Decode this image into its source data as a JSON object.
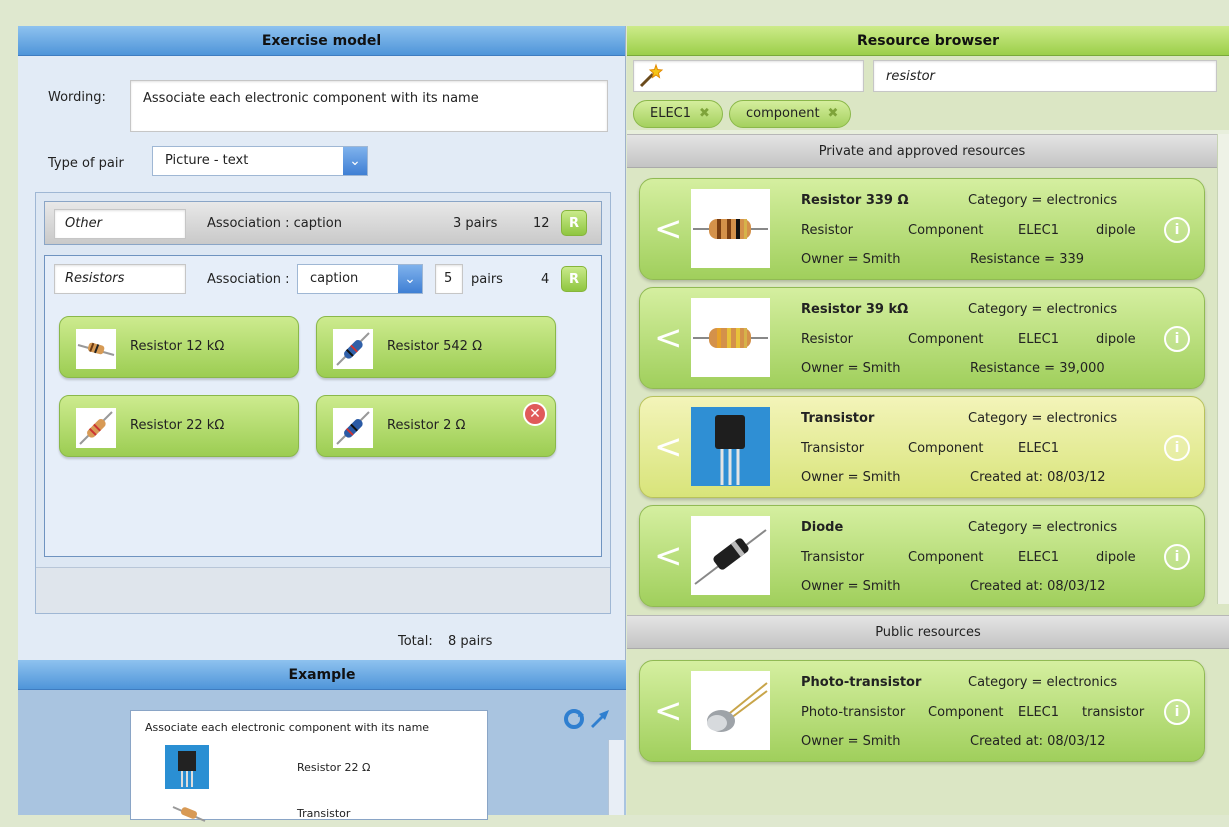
{
  "exercise_panel": {
    "title": "Exercise model",
    "wording_label": "Wording:",
    "wording_value": "Associate each electronic component with its name",
    "pair_type_label": "Type of pair",
    "pair_type_value": "Picture - text",
    "groups": [
      {
        "name": "Other",
        "association_label": "Association : caption",
        "pairs_label": "3 pairs",
        "count": "12",
        "r_label": "R"
      },
      {
        "name": "Resistors",
        "association_label": "Association :",
        "association_value": "caption",
        "pairs_value": "5",
        "pairs_unit": "pairs",
        "count": "4",
        "r_label": "R",
        "items": [
          {
            "label": "Resistor 12 kΩ",
            "icon": "resistor-icon"
          },
          {
            "label": "Resistor 542 Ω",
            "icon": "resistor-blue-icon"
          },
          {
            "label": "Resistor 22 kΩ",
            "icon": "resistor-icon"
          },
          {
            "label": "Resistor 2 Ω",
            "icon": "resistor-blue-icon"
          }
        ]
      }
    ],
    "total_label": "Total:",
    "total_value": "8 pairs"
  },
  "example_panel": {
    "title": "Example",
    "preview_heading": "Associate each electronic component with its name",
    "preview_rows": [
      "Resistor 22 Ω",
      "Transistor"
    ]
  },
  "resource_browser": {
    "title": "Resource browser",
    "search_value": "resistor",
    "filters": [
      {
        "label": "ELEC1"
      },
      {
        "label": "component"
      }
    ],
    "sections": [
      {
        "title": "Private and approved resources",
        "cards": [
          {
            "title": "Resistor 339 Ω",
            "category": "Category = electronics",
            "tags": [
              "Resistor",
              "Component",
              "ELEC1",
              "dipole"
            ],
            "owner": "Owner = Smith",
            "extra": "Resistance = 339",
            "style": "green"
          },
          {
            "title": "Resistor 39 kΩ",
            "category": "Category = electronics",
            "tags": [
              "Resistor",
              "Component",
              "ELEC1",
              "dipole"
            ],
            "owner": "Owner = Smith",
            "extra": "Resistance = 39,000",
            "style": "green"
          },
          {
            "title": "Transistor",
            "category": "Category = electronics",
            "tags": [
              "Transistor",
              "Component",
              "ELEC1",
              ""
            ],
            "owner": "Owner = Smith",
            "extra": "Created at: 08/03/12",
            "style": "yellow"
          },
          {
            "title": "Diode",
            "category": "Category = electronics",
            "tags": [
              "Transistor",
              "Component",
              "ELEC1",
              "dipole"
            ],
            "owner": "Owner = Smith",
            "extra": "Created at: 08/03/12",
            "style": "green"
          }
        ]
      },
      {
        "title": "Public resources",
        "cards": [
          {
            "title": "Photo-transistor",
            "category": "Category = electronics",
            "tags": [
              "Photo-transistor",
              "Component",
              "ELEC1",
              "transistor"
            ],
            "owner": "Owner = Smith",
            "extra": "Created at: 08/03/12",
            "style": "green"
          }
        ]
      }
    ]
  },
  "colors": {
    "panel_blue": "#4f95d9",
    "panel_green": "#9ccf4a",
    "tile_green": "#a4d05e",
    "selected_yellow": "#d8e47a",
    "delete_red": "#e05a5a"
  }
}
